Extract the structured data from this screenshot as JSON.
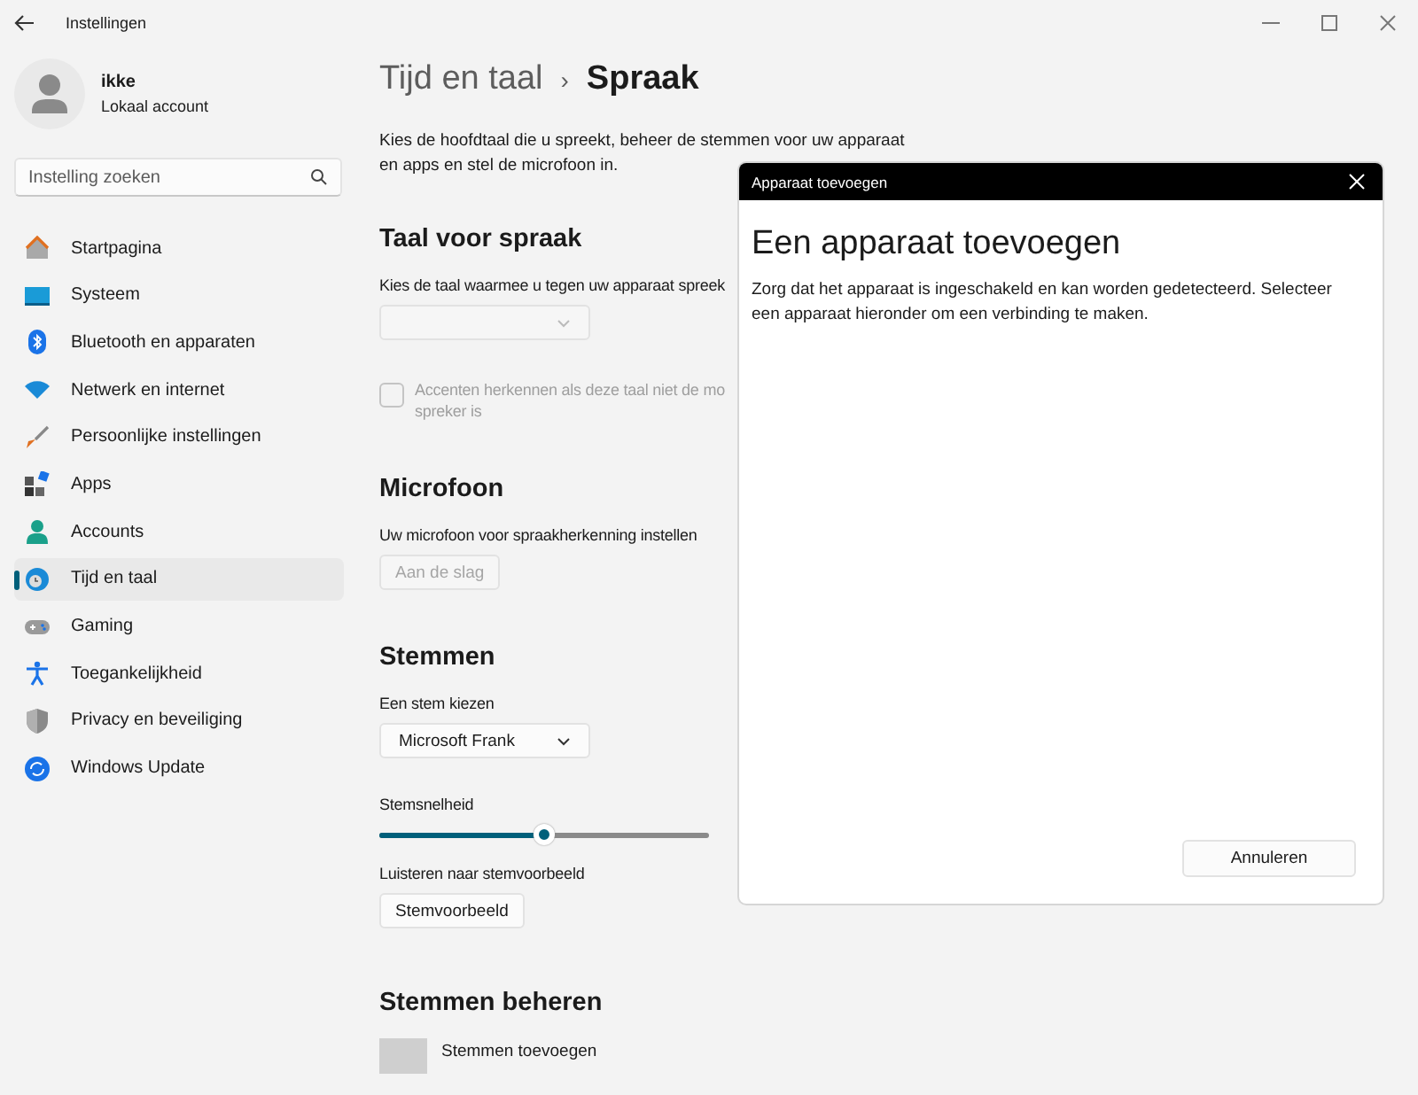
{
  "window": {
    "title": "Instellingen"
  },
  "account": {
    "name": "ikke",
    "type": "Lokaal account"
  },
  "search": {
    "placeholder": "Instelling zoeken"
  },
  "sidebar": {
    "items": [
      {
        "label": "Startpagina",
        "selected": false
      },
      {
        "label": "Systeem",
        "selected": false
      },
      {
        "label": "Bluetooth en apparaten",
        "selected": false
      },
      {
        "label": "Netwerk en internet",
        "selected": false
      },
      {
        "label": "Persoonlijke instellingen",
        "selected": false
      },
      {
        "label": "Apps",
        "selected": false
      },
      {
        "label": "Accounts",
        "selected": false
      },
      {
        "label": "Tijd en taal",
        "selected": true
      },
      {
        "label": "Gaming",
        "selected": false
      },
      {
        "label": "Toegankelijkheid",
        "selected": false
      },
      {
        "label": "Privacy en beveiliging",
        "selected": false
      },
      {
        "label": "Windows Update",
        "selected": false
      }
    ]
  },
  "breadcrumb": {
    "parent": "Tijd en taal",
    "separator": "›",
    "current": "Spraak"
  },
  "description": [
    "Kies de hoofdtaal die u spreekt, beheer de stemmen voor uw apparaat",
    "en apps en stel de microfoon in."
  ],
  "speech_language": {
    "heading": "Taal voor spraak",
    "label": "Kies de taal waarmee u tegen uw apparaat spreek",
    "dropdown_disabled": true,
    "checkbox": {
      "lines": [
        "Accenten herkennen als deze taal niet de mo",
        "spreker is"
      ],
      "checked": false,
      "disabled": true
    }
  },
  "microphone": {
    "heading": "Microfoon",
    "label": "Uw microfoon voor spraakherkenning instellen",
    "button": {
      "label": "Aan de slag",
      "disabled": true
    }
  },
  "voices": {
    "heading": "Stemmen",
    "voice_label": "Een stem kiezen",
    "voice": "Microsoft Frank",
    "speed_label": "Stemsnelheid",
    "speed": {
      "level": 0.5
    },
    "preview_label": "Luisteren naar stemvoorbeeld",
    "preview_button": "Stemvoorbeeld"
  },
  "manage_voices": {
    "heading": "Stemmen beheren",
    "add_voices": "Stemmen toevoegen"
  },
  "dialog": {
    "title": "Apparaat toevoegen",
    "heading": "Een apparaat toevoegen",
    "text": "Zorg dat het apparaat is ingeschakeld en kan worden gedetecteerd. Selecteer een apparaat hieronder om een verbinding te maken.",
    "cancel": "Annuleren"
  }
}
